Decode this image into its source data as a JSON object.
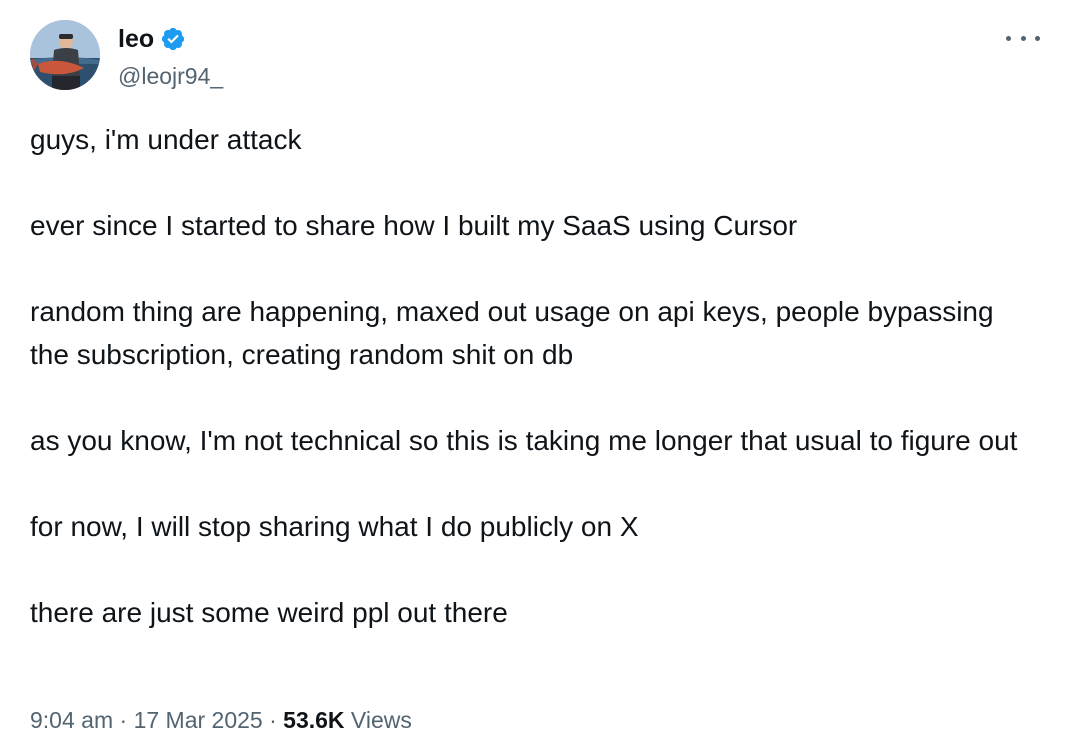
{
  "author": {
    "display_name": "leo",
    "handle": "@leojr94_",
    "verified": true,
    "verified_color": "#1d9bf0"
  },
  "menu": {
    "icon": "more-horizontal-icon"
  },
  "tweet": {
    "paragraphs": [
      "guys, i'm under attack",
      "ever since I started to share how I built my SaaS using Cursor",
      "random thing are happening, maxed out usage on api keys, people bypassing the subscription, creating random shit on db",
      "as you know, I'm not technical so this is taking me longer that usual to figure out",
      "for now, I will stop sharing what I do publicly on X",
      "there are just some weird ppl out there"
    ]
  },
  "meta": {
    "time": "9:04 am",
    "separator": " · ",
    "date": "17 Mar 2025",
    "views_count": "53.6K",
    "views_label": "Views"
  }
}
